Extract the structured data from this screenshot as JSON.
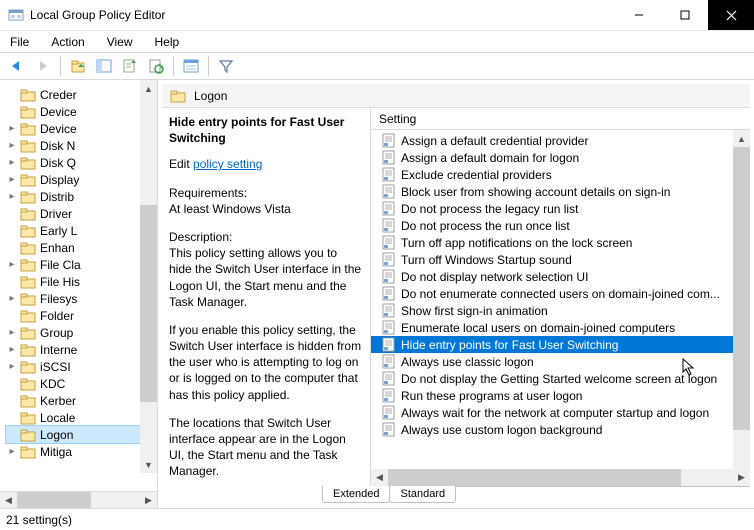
{
  "window": {
    "title": "Local Group Policy Editor"
  },
  "menu": {
    "file": "File",
    "action": "Action",
    "view": "View",
    "help": "Help"
  },
  "tree": {
    "items": [
      {
        "label": "Creder",
        "expander": ""
      },
      {
        "label": "Device",
        "expander": ""
      },
      {
        "label": "Device",
        "expander": "▸"
      },
      {
        "label": "Disk N",
        "expander": "▸"
      },
      {
        "label": "Disk Q",
        "expander": "▸"
      },
      {
        "label": "Display",
        "expander": "▸"
      },
      {
        "label": "Distrib",
        "expander": "▸"
      },
      {
        "label": "Driver",
        "expander": ""
      },
      {
        "label": "Early L",
        "expander": ""
      },
      {
        "label": "Enhan",
        "expander": ""
      },
      {
        "label": "File Cla",
        "expander": "▸"
      },
      {
        "label": "File His",
        "expander": ""
      },
      {
        "label": "Filesys",
        "expander": "▸"
      },
      {
        "label": "Folder",
        "expander": ""
      },
      {
        "label": "Group",
        "expander": "▸"
      },
      {
        "label": "Interne",
        "expander": "▸"
      },
      {
        "label": "iSCSI",
        "expander": "▸"
      },
      {
        "label": "KDC",
        "expander": ""
      },
      {
        "label": "Kerber",
        "expander": ""
      },
      {
        "label": "Locale",
        "expander": ""
      },
      {
        "label": "Logon",
        "expander": "",
        "selected": true
      },
      {
        "label": "Mitiga",
        "expander": "▸"
      }
    ]
  },
  "header": {
    "title": "Logon"
  },
  "description": {
    "selected_name": "Hide entry points for Fast User Switching",
    "edit_prefix": "Edit ",
    "edit_link": "policy setting",
    "req_label": "Requirements:",
    "req_value": "At least Windows Vista",
    "desc_label": "Description:",
    "desc_p1": "This policy setting allows you to hide the Switch User interface in the Logon UI, the Start menu and the Task Manager.",
    "desc_p2": "If you enable this policy setting, the Switch User interface is hidden from the user who is attempting to log on or is logged on to the computer that has this policy applied.",
    "desc_p3": "The locations that Switch User interface appear are in the Logon UI, the Start menu and the Task Manager."
  },
  "list": {
    "column_header": "Setting",
    "items": [
      "Assign a default credential provider",
      "Assign a default domain for logon",
      "Exclude credential providers",
      "Block user from showing account details on sign-in",
      "Do not process the legacy run list",
      "Do not process the run once list",
      "Turn off app notifications on the lock screen",
      "Turn off Windows Startup sound",
      "Do not display network selection UI",
      "Do not enumerate connected users on domain-joined com...",
      "Show first sign-in animation",
      "Enumerate local users on domain-joined computers",
      "Hide entry points for Fast User Switching",
      "Always use classic logon",
      "Do not display the Getting Started welcome screen at logon",
      "Run these programs at user logon",
      "Always wait for the network at computer startup and logon",
      "Always use custom logon background"
    ],
    "selected_index": 12
  },
  "tabs": {
    "extended": "Extended",
    "standard": "Standard"
  },
  "status": {
    "text": "21 setting(s)"
  }
}
